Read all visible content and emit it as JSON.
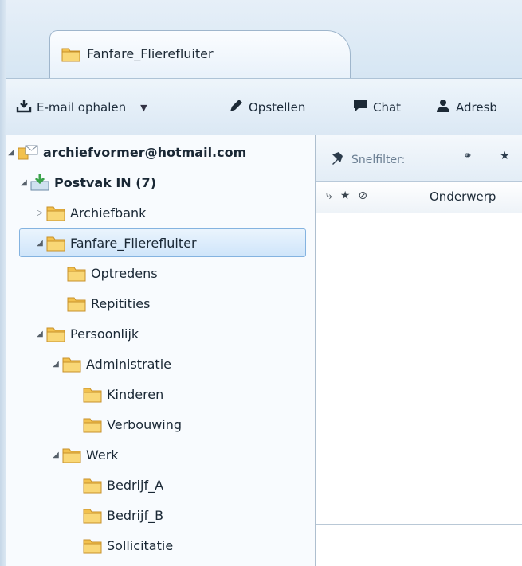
{
  "tab": {
    "label": "Fanfare_Flierefluiter"
  },
  "toolbar": {
    "get_mail": "E-mail ophalen",
    "compose": "Opstellen",
    "chat": "Chat",
    "addressbook": "Adresb"
  },
  "filterbar": {
    "quick_filter": "Snelfilter:"
  },
  "messages": {
    "subject_col": "Onderwerp"
  },
  "folders": [
    {
      "label": "archiefvormer@hotmail.com",
      "icon": "account-icon",
      "expanded": true,
      "bold": true
    },
    {
      "label": "Postvak IN (7)",
      "icon": "inbox-icon",
      "expanded": true,
      "bold": true
    },
    {
      "label": "Archiefbank",
      "icon": "folder-icon",
      "expanded": false
    },
    {
      "label": "Fanfare_Flierefluiter",
      "icon": "folder-icon",
      "expanded": true,
      "selected": true
    },
    {
      "label": "Optredens",
      "icon": "folder-icon"
    },
    {
      "label": "Repitities",
      "icon": "folder-icon"
    },
    {
      "label": "Persoonlijk",
      "icon": "folder-icon",
      "expanded": true
    },
    {
      "label": "Administratie",
      "icon": "folder-icon",
      "expanded": true
    },
    {
      "label": "Kinderen",
      "icon": "folder-icon"
    },
    {
      "label": "Verbouwing",
      "icon": "folder-icon"
    },
    {
      "label": "Werk",
      "icon": "folder-icon",
      "expanded": true
    },
    {
      "label": "Bedrijf_A",
      "icon": "folder-icon"
    },
    {
      "label": "Bedrijf_B",
      "icon": "folder-icon"
    },
    {
      "label": "Sollicitatie",
      "icon": "folder-icon"
    }
  ],
  "colors": {
    "folder": "#f2c14e",
    "selection": "#cfe5fa",
    "accent_green": "#3aa34a"
  }
}
